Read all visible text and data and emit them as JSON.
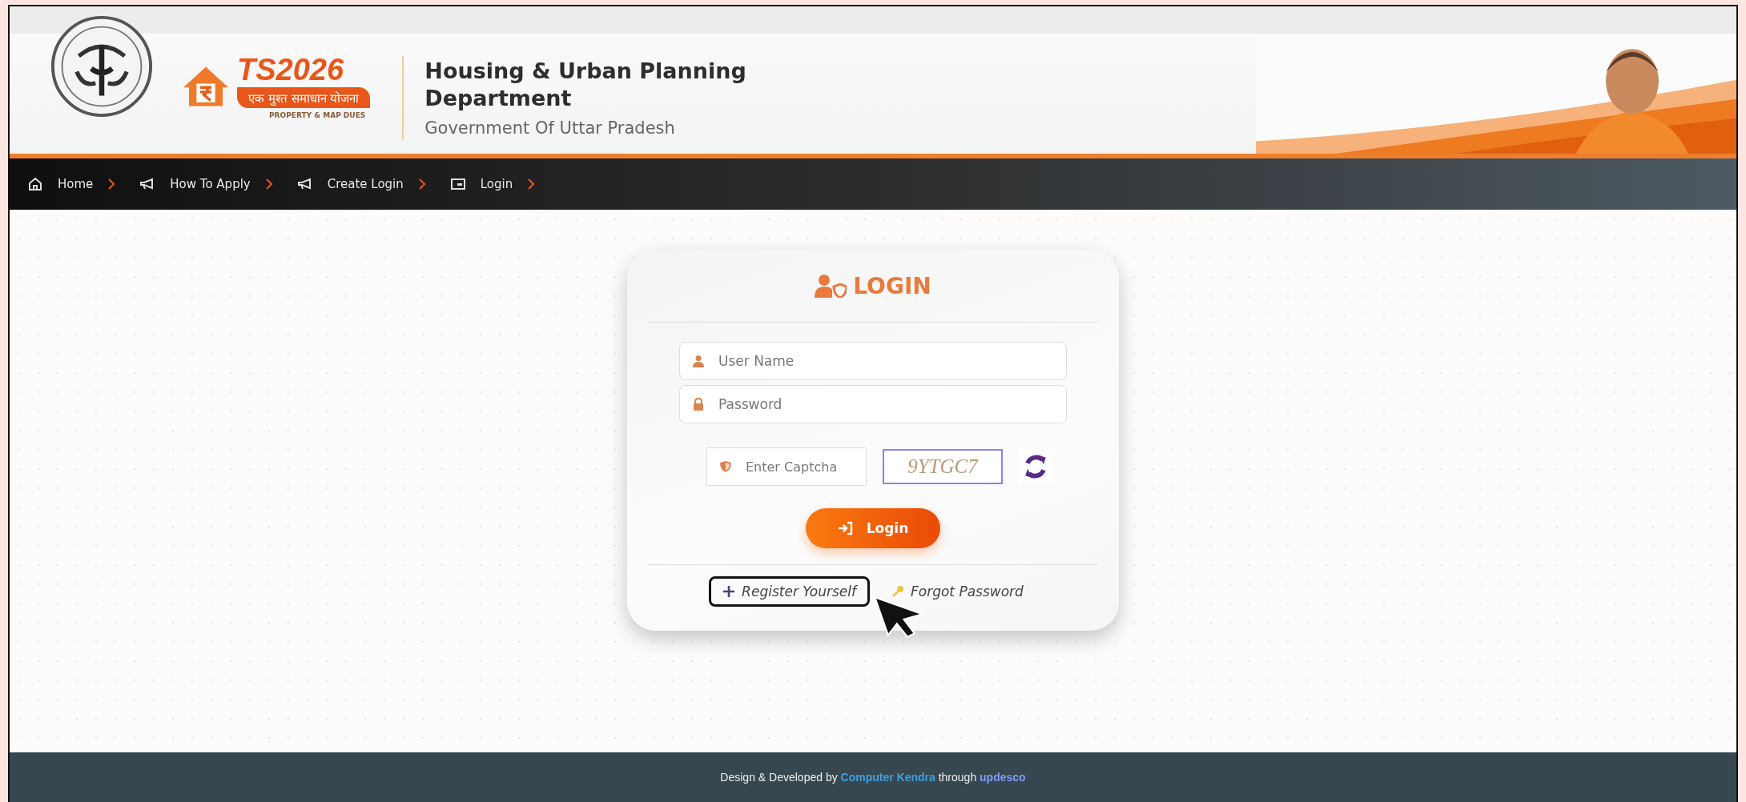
{
  "header": {
    "logo": {
      "mark": "TS2026",
      "tagline": "एक मुश्त समाधान योजना",
      "subtitle": "PROPERTY & MAP DUES"
    },
    "title": "Housing & Urban Planning Department",
    "subtitle": "Government Of Uttar Pradesh"
  },
  "nav": {
    "items": [
      {
        "label": "Home",
        "kind": "home"
      },
      {
        "label": "How To Apply",
        "kind": "megaphone"
      },
      {
        "label": "Create Login",
        "kind": "megaphone"
      },
      {
        "label": "Login",
        "kind": "card"
      }
    ]
  },
  "login": {
    "title": "LOGIN",
    "fields": [
      {
        "placeholder": "User Name",
        "kind": "user"
      },
      {
        "placeholder": "Password",
        "kind": "lock"
      }
    ],
    "captcha": {
      "placeholder": "Enter Captcha",
      "code": "9YTGC7"
    },
    "button": "Login",
    "links": [
      {
        "label": "Register Yourself",
        "kind": "plus",
        "highlighted": true
      },
      {
        "label": "Forgot Password",
        "kind": "key",
        "highlighted": false
      }
    ]
  },
  "footer": {
    "prefix": "Design & Developed by",
    "developer": "Computer Kendra",
    "middle": "through",
    "partner": "updesco"
  }
}
